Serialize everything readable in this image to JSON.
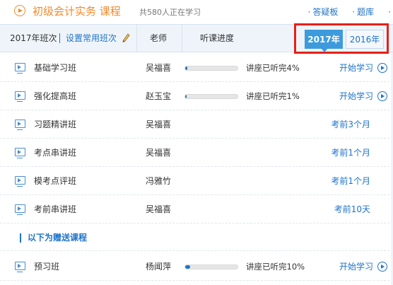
{
  "header": {
    "course_title": "初级会计实务  课程",
    "learners": "共580人正在学习",
    "links": [
      "答疑板",
      "题库"
    ]
  },
  "columns": {
    "class": "2017年班次",
    "set_common": "设置常用班次",
    "teacher": "老师",
    "progress": "听课进度"
  },
  "years": [
    "2017年",
    "2016年"
  ],
  "selected_year": "2017年",
  "rows": [
    {
      "name": "基础学习班",
      "teacher": "吴福喜",
      "progress": 0.04,
      "progress_text": "讲座已听完4%",
      "action": "开始学习"
    },
    {
      "name": "强化提高班",
      "teacher": "赵玉宝",
      "progress": 0.01,
      "progress_text": "讲座已听完1%",
      "action": "开始学习"
    },
    {
      "name": "习题精讲班",
      "teacher": "吴福喜",
      "due": "考前3个月"
    },
    {
      "name": "考点串讲班",
      "teacher": "吴福喜",
      "due": "考前1个月"
    },
    {
      "name": "模考点评班",
      "teacher": "冯雅竹",
      "due": "考前1个月"
    },
    {
      "name": "考前串讲班",
      "teacher": "吴福喜",
      "due": "考前10天"
    }
  ],
  "gift_title": "以下为赠送课程",
  "gift_rows": [
    {
      "name": "预习班",
      "teacher": "杨闻萍",
      "progress": 0.1,
      "progress_text": "讲座已听完10%",
      "action": "开始学习"
    }
  ],
  "colors": {
    "accent": "#f08a2c",
    "link": "#1f74c8",
    "highlight_border": "#e6201a",
    "active_tab": "#3d9bdc"
  }
}
